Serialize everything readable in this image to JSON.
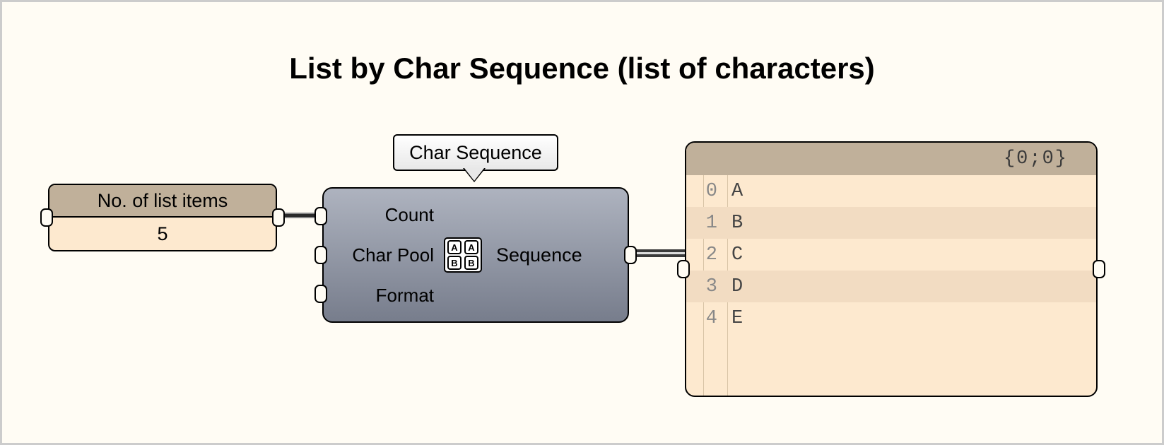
{
  "title": "List by Char Sequence (list of characters)",
  "numpanel": {
    "header": "No. of list items",
    "value": "5"
  },
  "tooltip": "Char Sequence",
  "component": {
    "inputs": [
      "Count",
      "Char Pool",
      "Format"
    ],
    "output": "Sequence",
    "icon_label": "AA BB"
  },
  "outpanel": {
    "path": "{0;0}",
    "rows": [
      {
        "idx": "0",
        "val": "A"
      },
      {
        "idx": "1",
        "val": "B"
      },
      {
        "idx": "2",
        "val": "C"
      },
      {
        "idx": "3",
        "val": "D"
      },
      {
        "idx": "4",
        "val": "E"
      }
    ]
  }
}
